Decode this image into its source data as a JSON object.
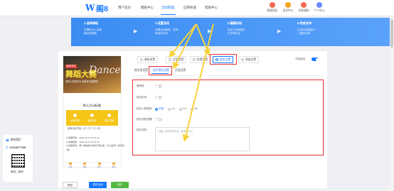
{
  "nav": {
    "logo_text": "阁8",
    "items": [
      "用户首页",
      "模板中心",
      "活动管理",
      "应用商城",
      "帮助中心"
    ],
    "active_index": 2,
    "right_icons": [
      {
        "label": "客服团队",
        "color": "#f26a4f",
        "icon": "headset-icon"
      },
      {
        "label": "会员中心",
        "color": "#f5a623",
        "icon": "crown-icon"
      },
      {
        "label": "消息通知",
        "color": "#f26a4f",
        "icon": "bell-icon"
      },
      {
        "label": "个人中心",
        "color": "#6b8cff",
        "icon": "user-icon"
      }
    ]
  },
  "banner": {
    "steps": [
      {
        "title": "1.选择模板",
        "desc": [
          "在模板中心选择",
          "喜欢的模板"
        ]
      },
      {
        "title": "2.设置活动",
        "desc": [
          "设置活动规则、奖项",
          "等相关内容"
        ]
      },
      {
        "title": "3.编辑活动",
        "desc": [
          "自定义页面图片",
          "文字等内容"
        ]
      },
      {
        "title": "4.完成发布",
        "desc": [
          "生成活动链接与",
          "二维码分享"
        ]
      }
    ]
  },
  "contact": {
    "service_label": "联系我们",
    "phone": "17615277780",
    "qr_caption": "微信二维码"
  },
  "preview": {
    "badge": "独家冠名",
    "poster_title": "舞蹈大赛",
    "poster_deco": "Dance",
    "poster_sub": "赛事火热进行中 快来参与投票吧",
    "title": "默认活动标题",
    "countdown": [
      {
        "label": "活动天数",
        "icon": "calendar-icon"
      },
      {
        "label": "参赛选手",
        "icon": "person-icon"
      },
      {
        "label": "累计票数",
        "icon": "ticket-icon"
      }
    ],
    "tip": "距离活动开始 1 天 1 时 1 分 1 秒",
    "info": [
      "● 投票开始：2024-11-27 10:47:11",
      "● 投票结束：2024-12-27 10:47:11",
      "● 投票规则：每个微信用户每天可投3票，可以给同一选手投",
      "  1票"
    ],
    "bar": [
      {
        "label": "首页",
        "icon": "home-icon"
      },
      {
        "label": "报名",
        "icon": "signup-icon"
      },
      {
        "label": "排行",
        "icon": "rank-icon"
      },
      {
        "label": "搜索",
        "icon": "search-icon"
      }
    ]
  },
  "buttons": {
    "preview": "预览",
    "publish": "发布活动",
    "save": "保存"
  },
  "top_tabs": [
    "基础设置",
    "页面设置",
    "投票设置",
    "报名设置",
    "高级设置"
  ],
  "top_tab_active": 3,
  "switch_label": "开启报名",
  "switch_on": true,
  "sub_tabs": [
    "报名表设置",
    "选手报名设置",
    "页面设置"
  ],
  "sub_tab_active": 1,
  "form": {
    "fields": [
      {
        "label": "需审核",
        "type": "toggle",
        "on": false
      },
      {
        "label": "报名时间",
        "type": "toggle",
        "on": false
      },
      {
        "label": "报名人数限制",
        "type": "radio"
      },
      {
        "label": "报名须知提醒",
        "type": "toggle",
        "on": false
      },
      {
        "label": "报名须知",
        "type": "textarea"
      }
    ],
    "radio_options": [
      "不限",
      "1人",
      "2人",
      "3人"
    ],
    "radio_selected": 0,
    "textarea_placeholder": "请输入报名须知内容（最多200字）"
  },
  "colors": {
    "accent": "#1677ff",
    "highlight": "#e83030",
    "arrow": "#f7d23a"
  }
}
